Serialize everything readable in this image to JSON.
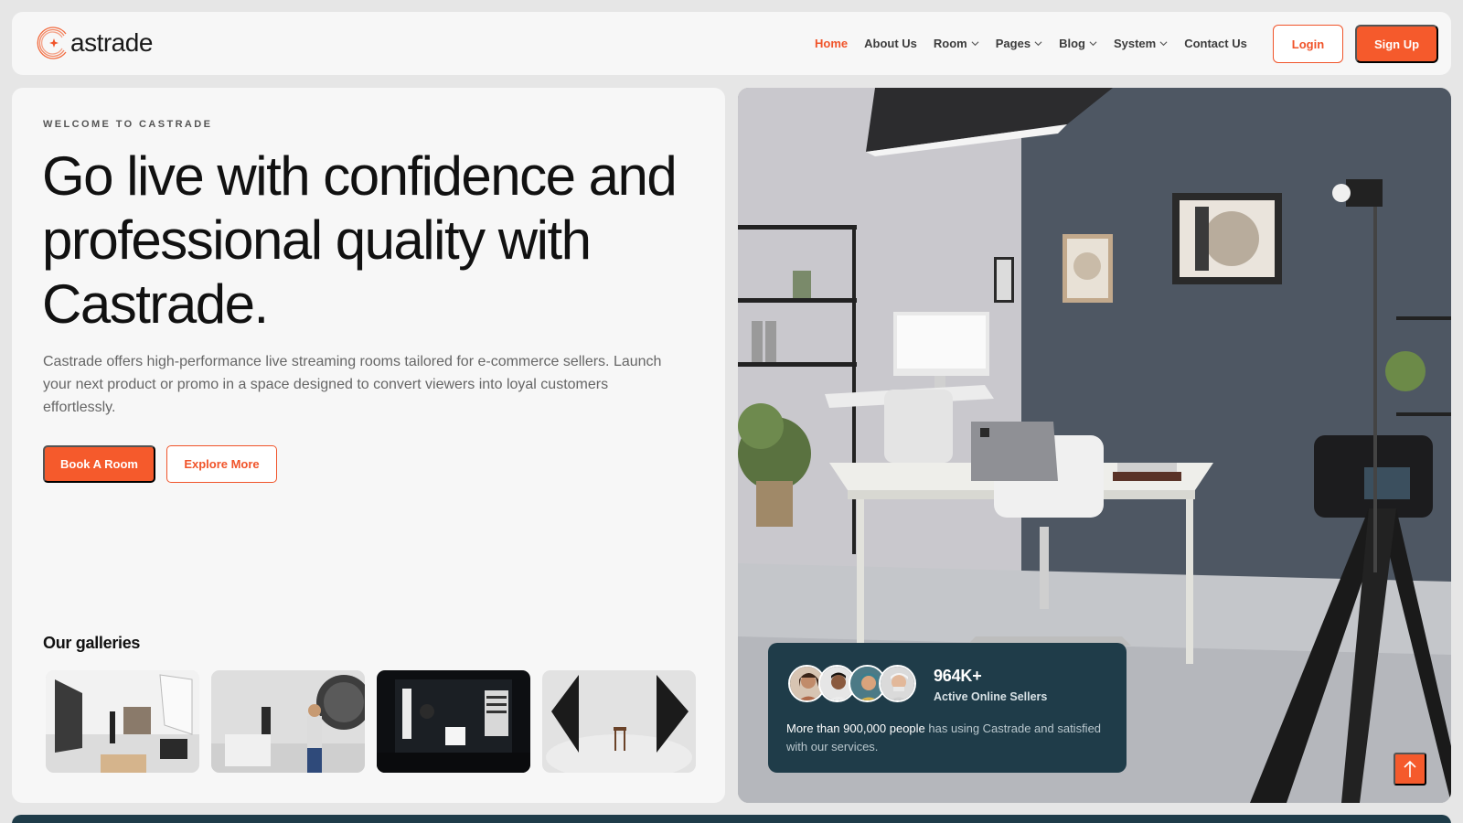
{
  "brand": {
    "name": "astrade",
    "accent": "#f55a2c",
    "dark": "#1f3c49"
  },
  "nav": {
    "items": [
      {
        "label": "Home",
        "active": true,
        "dropdown": false
      },
      {
        "label": "About Us",
        "active": false,
        "dropdown": false
      },
      {
        "label": "Room",
        "active": false,
        "dropdown": true
      },
      {
        "label": "Pages",
        "active": false,
        "dropdown": true
      },
      {
        "label": "Blog",
        "active": false,
        "dropdown": true
      },
      {
        "label": "System",
        "active": false,
        "dropdown": true
      },
      {
        "label": "Contact Us",
        "active": false,
        "dropdown": false
      }
    ],
    "login_label": "Login",
    "signup_label": "Sign Up"
  },
  "hero": {
    "eyebrow": "WELCOME TO CASTRADE",
    "headline": "Go live with confidence and professional quality with Castrade.",
    "description": "Castrade offers high-performance live streaming rooms tailored for e-commerce sellers. Launch your next product or promo in a space designed to convert viewers into loyal customers effortlessly.",
    "primary_cta": "Book A Room",
    "secondary_cta": "Explore More"
  },
  "gallery": {
    "title": "Our galleries",
    "items": [
      "gallery-photo-1",
      "gallery-photo-2",
      "gallery-photo-3",
      "gallery-photo-4"
    ]
  },
  "stats": {
    "number": "964K+",
    "label": "Active Online Sellers",
    "text_strong": "More than 900,000 people",
    "text_rest": " has using Castrade and satisfied with our services."
  },
  "icons": {
    "scroll_top": "arrow-up-icon",
    "chevron": "chevron-down-icon",
    "logo": "castrade-logo-icon"
  }
}
